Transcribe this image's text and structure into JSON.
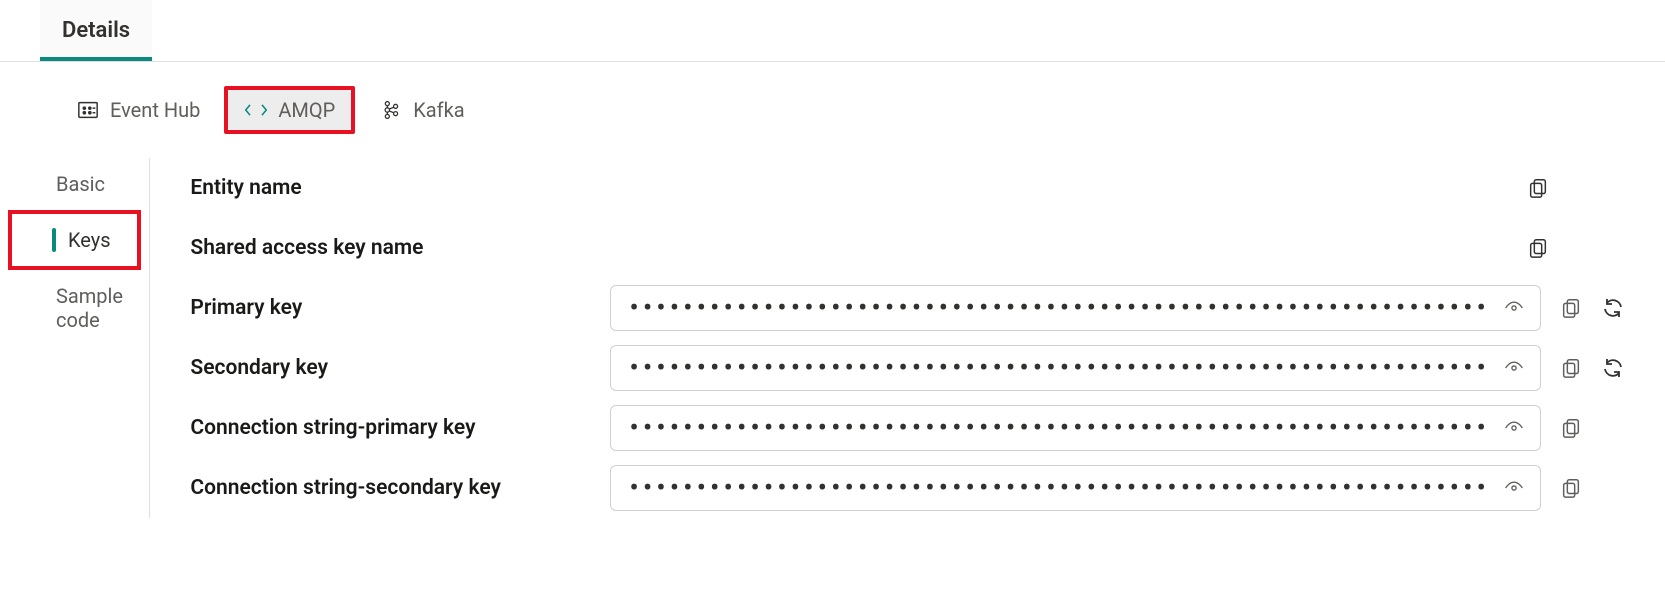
{
  "topTabs": {
    "details": "Details"
  },
  "protocol": {
    "eventHub": "Event Hub",
    "amqp": "AMQP",
    "kafka": "Kafka"
  },
  "sideNav": {
    "basic": "Basic",
    "keys": "Keys",
    "sampleCode": "Sample code"
  },
  "labels": {
    "entityName": "Entity name",
    "sharedAccessKeyName": "Shared access key name",
    "primaryKey": "Primary key",
    "secondaryKey": "Secondary key",
    "connStrPrimary": "Connection string-primary key",
    "connStrSecondary": "Connection string-secondary key"
  },
  "masks": {
    "primaryKey": "••••••••••••••••••••••••••••••••••••••••••••••••••••••••••••••••",
    "secondaryKey": "••••••••••••••••••••••••••••••••••••••••••••••••••••••••••••••••",
    "connStrPrimary": "••••••••••••••••••••••••••••••••••••••••••••••••••••••••••••••••",
    "connStrSecondary": "••••••••••••••••••••••••••••••••••••••••••••••••••••••••••••••••"
  }
}
